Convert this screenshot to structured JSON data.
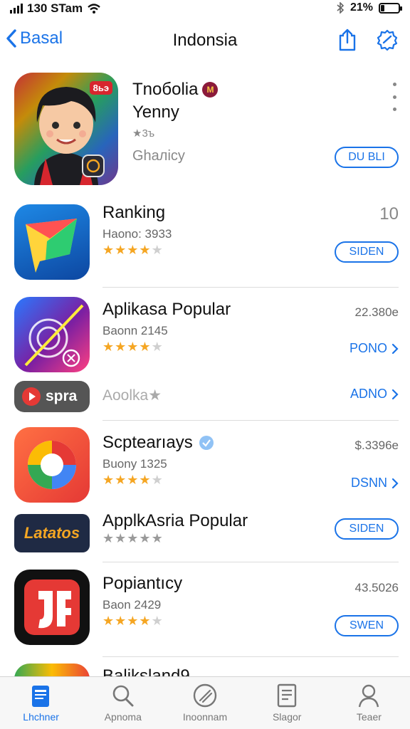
{
  "status": {
    "carrier": "130 STam",
    "battery": "21%",
    "battery_fraction": 0.21
  },
  "nav": {
    "back_label": "Basal",
    "title": "Indonsia"
  },
  "featured": {
    "name": "Tnoбolia",
    "name2": "Yenny",
    "rating_text": "★3ъ",
    "category": "Ghaлicy",
    "button_label": "DU BLI",
    "badge": "8ьэ"
  },
  "apps": [
    {
      "name": "Ranking",
      "sub": "Haono: 3933",
      "stars": 4,
      "meta": "10",
      "action": "SIDEN",
      "action_type": "pill"
    },
    {
      "name": "Aplikasa Popular",
      "sub": "Baonn 2145",
      "stars": 4,
      "meta": "22.380e",
      "action": "PONO",
      "action_type": "link"
    },
    {
      "name": "",
      "sub": "Aoolka★",
      "stars": 0,
      "meta": "",
      "action": "ADNO",
      "action_type": "link",
      "icon_text": "spra"
    },
    {
      "name": "Scptearıays",
      "sub": "Buony 1325",
      "stars": 4,
      "meta": "$.3396e",
      "action": "DSNN",
      "action_type": "link"
    },
    {
      "name": "ApplkAsria Popular",
      "sub": "",
      "stars": 0,
      "meta": "",
      "action": "SIDEN",
      "action_type": "pill",
      "icon_text": "Latatos"
    },
    {
      "name": "Popiantıcy",
      "sub": "Baon 2429",
      "stars": 4,
      "meta": "43.5026",
      "action": "SWEN",
      "action_type": "pill"
    },
    {
      "name": "Baliksland9",
      "sub": "",
      "stars": 0,
      "meta": "",
      "action": "",
      "action_type": "none"
    }
  ],
  "tabs": [
    {
      "label": "Lhchner",
      "icon": "today-icon",
      "active": true
    },
    {
      "label": "Apnoma",
      "icon": "search-icon",
      "active": false
    },
    {
      "label": "Inoonnam",
      "icon": "slash-circle-icon",
      "active": false
    },
    {
      "label": "Slagor",
      "icon": "document-icon",
      "active": false
    },
    {
      "label": "Teaer",
      "icon": "person-icon",
      "active": false
    }
  ],
  "colors": {
    "accent": "#1a73e8",
    "star": "#f5a623"
  }
}
